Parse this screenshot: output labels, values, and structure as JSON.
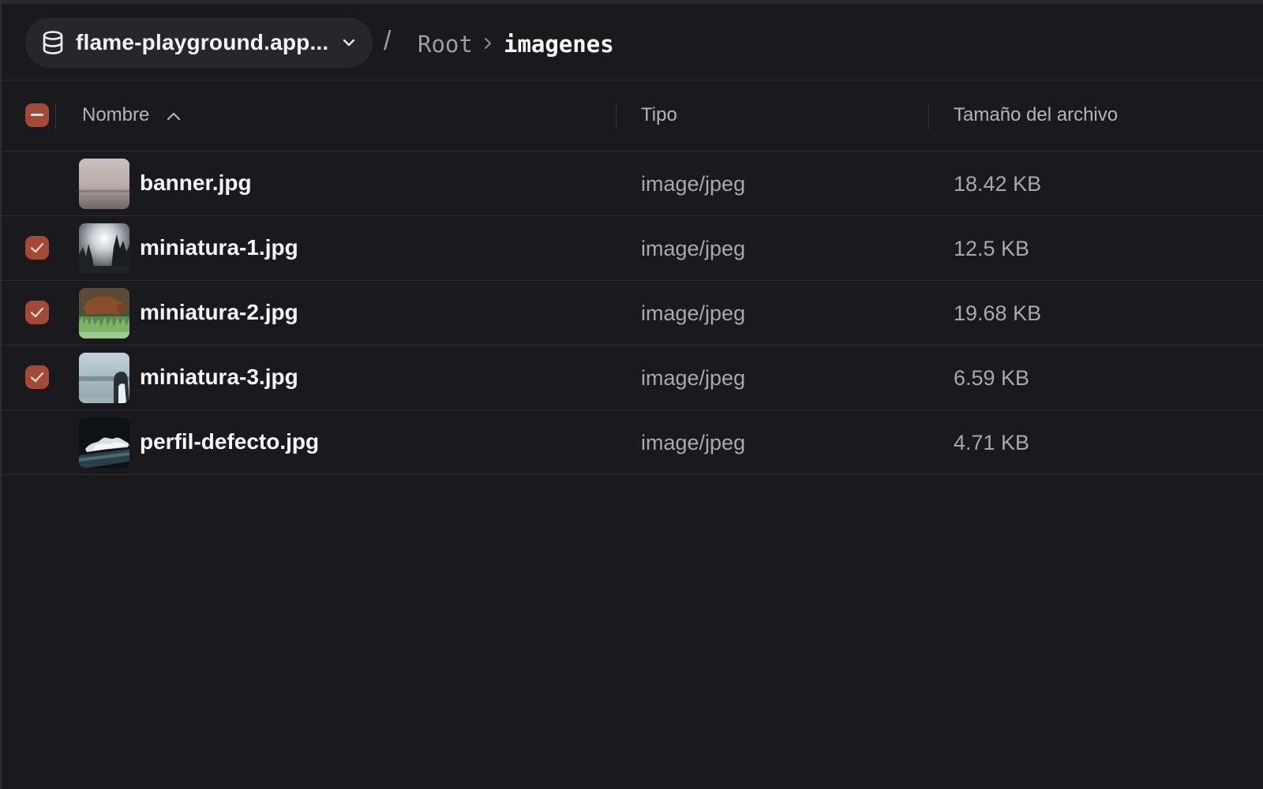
{
  "header": {
    "bucket_name": "flame-playground.app...",
    "separator": "/",
    "breadcrumb": {
      "root": "Root",
      "current": "imagenes"
    }
  },
  "table": {
    "columns": {
      "name": "Nombre",
      "type": "Tipo",
      "size": "Tamaño del archivo"
    },
    "sort": "ascending",
    "select_all_state": "indeterminate",
    "rows": [
      {
        "name": "banner.jpg",
        "type": "image/jpeg",
        "size": "18.42 KB",
        "selected": false,
        "thumbnail": "hazy-landscape"
      },
      {
        "name": "miniatura-1.jpg",
        "type": "image/jpeg",
        "size": "12.5 KB",
        "selected": true,
        "thumbnail": "forest-sun"
      },
      {
        "name": "miniatura-2.jpg",
        "type": "image/jpeg",
        "size": "19.68 KB",
        "selected": true,
        "thumbnail": "dog-on-grass"
      },
      {
        "name": "miniatura-3.jpg",
        "type": "image/jpeg",
        "size": "6.59 KB",
        "selected": true,
        "thumbnail": "person-by-sea"
      },
      {
        "name": "perfil-defecto.jpg",
        "type": "image/jpeg",
        "size": "4.71 KB",
        "selected": false,
        "thumbnail": "dark-wave"
      }
    ]
  },
  "colors": {
    "background": "#1a191e",
    "pill": "#27262b",
    "checkbox_accent": "#a14a36",
    "divider": "#2e2d33",
    "secondary_text": "#a9a8af"
  }
}
